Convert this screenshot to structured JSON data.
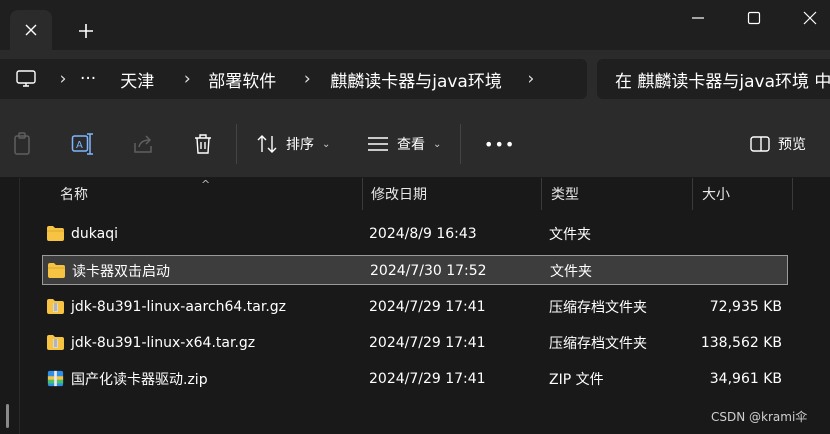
{
  "window": {
    "new_tab_symbol": "+"
  },
  "breadcrumb": {
    "more": "···",
    "items": [
      "天津",
      "部署软件",
      "麒麟读卡器与java环境"
    ]
  },
  "search": {
    "placeholder": "在 麒麟读卡器与java环境 中搜索"
  },
  "toolbar": {
    "sort_label": "排序",
    "view_label": "查看",
    "more_label": "•••",
    "preview_label": "预览"
  },
  "columns": {
    "name": "名称",
    "date": "修改日期",
    "type": "类型",
    "size": "大小"
  },
  "files": [
    {
      "name": "dukaqi",
      "date": "2024/8/9 16:43",
      "type": "文件夹",
      "size": "",
      "icon": "folder-icon",
      "selected": false
    },
    {
      "name": "读卡器双击启动",
      "date": "2024/7/30 17:52",
      "type": "文件夹",
      "size": "",
      "icon": "folder-icon",
      "selected": true
    },
    {
      "name": "jdk-8u391-linux-aarch64.tar.gz",
      "date": "2024/7/29 17:41",
      "type": "压缩存档文件夹",
      "size": "72,935 KB",
      "icon": "archive-folder-icon",
      "selected": false
    },
    {
      "name": "jdk-8u391-linux-x64.tar.gz",
      "date": "2024/7/29 17:41",
      "type": "压缩存档文件夹",
      "size": "138,562 KB",
      "icon": "archive-folder-icon",
      "selected": false
    },
    {
      "name": "国产化读卡器驱动.zip",
      "date": "2024/7/29 17:41",
      "type": "ZIP 文件",
      "size": "34,961 KB",
      "icon": "zip-icon",
      "selected": false
    }
  ],
  "watermark": "CSDN @krami伞",
  "colors": {
    "accent_folder": "#f6c342",
    "background": "#191919",
    "toolbar": "#2b2b2b"
  }
}
